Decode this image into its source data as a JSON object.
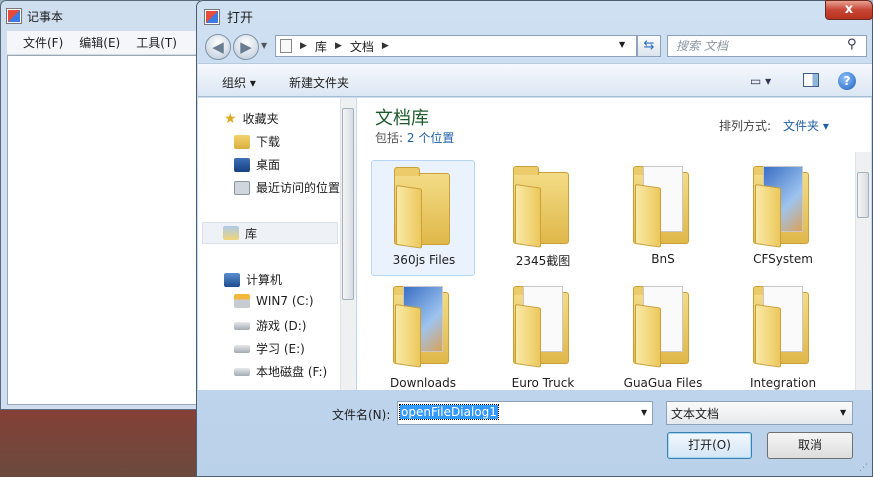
{
  "notepad": {
    "title": "记事本",
    "menu": [
      "文件(F)",
      "编辑(E)",
      "工具(T)"
    ]
  },
  "dialog": {
    "title": "打开",
    "close_label": "x",
    "address": {
      "crumbs": [
        "库",
        "文档"
      ]
    },
    "search_placeholder": "搜索 文档",
    "toolbar": {
      "organize": "组织 ▾",
      "new_folder": "新建文件夹"
    },
    "nav": {
      "favorites": "收藏夹",
      "downloads": "下载",
      "desktop": "桌面",
      "recent": "最近访问的位置",
      "library": "库",
      "computer": "计算机",
      "drive_c": "WIN7 (C:)",
      "drive_d": "游戏 (D:)",
      "drive_e": "学习 (E:)",
      "drive_f": "本地磁盘 (F:)"
    },
    "content": {
      "library_title": "文档库",
      "includes_label": "包括:",
      "includes_link": "2 个位置",
      "sort_label": "排列方式:",
      "sort_value": "文件夹 ▾",
      "folders": [
        "360js Files",
        "2345截图",
        "BnS",
        "CFSystem",
        "Downloads",
        "Euro Truck",
        "GuaGua Files",
        "Integration"
      ]
    },
    "filename_label": "文件名(N):",
    "filename_value": "openFileDialog1",
    "filetype_value": "文本文档",
    "open_button": "打开(O)",
    "cancel_button": "取消"
  },
  "colors": {
    "accent": "#1f5fa8",
    "library_title": "#1e5b2c",
    "selection": "#3399ff"
  }
}
